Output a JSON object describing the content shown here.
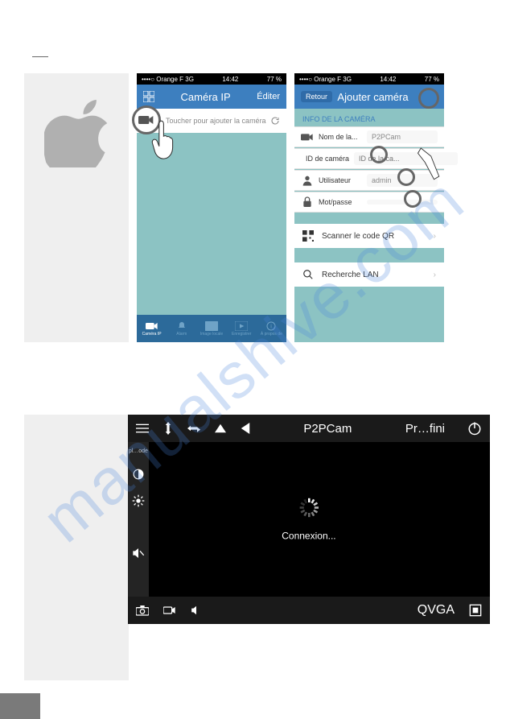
{
  "watermark": "manualshive.com",
  "statusbar": {
    "carrier": "••••○ Orange F  3G",
    "time": "14:42",
    "battery": "77 %"
  },
  "phone1": {
    "header_title": "Caméra IP",
    "header_right": "Éditer",
    "touch_text": "Toucher pour ajouter la caméra",
    "tabs": [
      "Caméra IP",
      "Alarm",
      "Image locale",
      "Enregistrer",
      "À propos de"
    ]
  },
  "phone2": {
    "header_back": "Retour",
    "header_title": "Ajouter caméra",
    "info_head": "INFO DE LA CAMÉRA",
    "rows": {
      "name_label": "Nom de la...",
      "name_value": "P2PCam",
      "id_label": "ID de caméra",
      "id_placeholder": "ID de la ca...",
      "user_label": "Utilisateur",
      "user_value": "admin",
      "pass_label": "Mot/passe"
    },
    "scan_qr": "Scanner le code QR",
    "lan_search": "Recherche LAN"
  },
  "player": {
    "title": "P2PCam",
    "right": "Pr…fini",
    "mode": "pl…ode",
    "status": "Connexion...",
    "quality": "QVGA"
  }
}
